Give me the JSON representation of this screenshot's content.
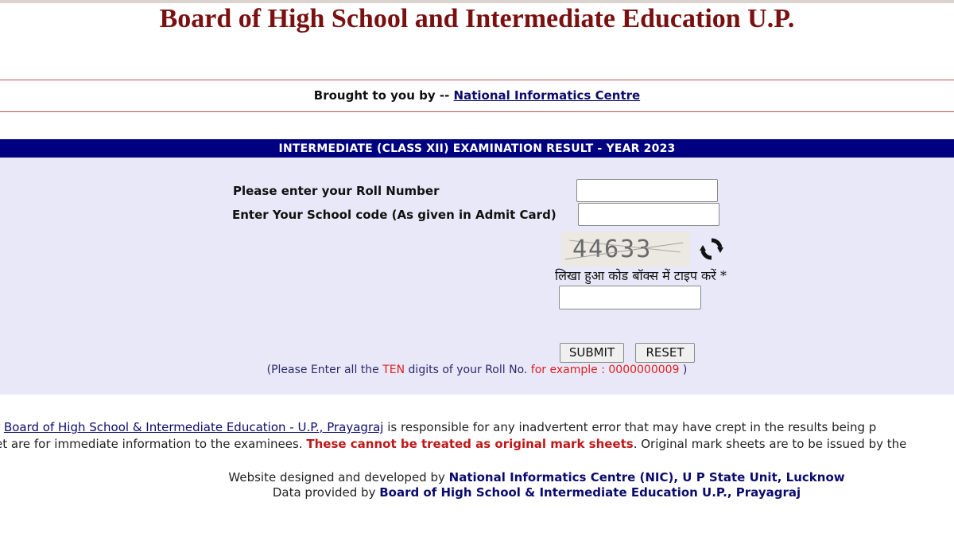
{
  "header": {
    "title": "Board of High School and Intermediate Education U.P."
  },
  "byline": {
    "prefix": "Brought to you by --",
    "link": "National Informatics Centre"
  },
  "form": {
    "section_title": "INTERMEDIATE (CLASS XII)  EXAMINATION RESULT - YEAR 2023",
    "roll_label": "Please enter your Roll Number",
    "roll_value": "",
    "school_label": "Enter Your School code (As given in Admit Card)",
    "school_value": "",
    "captcha_text": "44633",
    "captcha_prompt": "लिखा हुआ कोड बॉक्स में टाइप करें *",
    "captcha_value": "",
    "submit_label": "SUBMIT",
    "reset_label": "RESET",
    "note": {
      "part1": "(Please Enter all the ",
      "ten": "TEN",
      "part2": " digits of your Roll No. ",
      "example": "for example : 0000000009",
      "part3": " )"
    }
  },
  "disclaimer": {
    "line1_prefix": "r ",
    "line1_link": "Board of High School & Intermediate Education - U.P., Prayagraj",
    "line1_suffix": " is responsible for any inadvertent error that may have crept in the results being p",
    "line2_prefix": "et are for immediate information to the examinees. ",
    "line2_bold": "These cannot be treated as original mark sheets",
    "line2_suffix": ". Original mark sheets are to be issued by the"
  },
  "footer": {
    "line1_prefix": "Website designed and developed by ",
    "line1_bold": "National Informatics Centre (NIC), U P State Unit, Lucknow",
    "line2_prefix": "Data provided by ",
    "line2_bold": "Board of High School & Intermediate Education U.P., Prayagraj"
  },
  "colors": {
    "title": "#7a1010",
    "header_bar": "#000080",
    "panel_bg": "#e8e8f8",
    "link": "#0b0b6e",
    "highlight_red": "#e0201f"
  }
}
